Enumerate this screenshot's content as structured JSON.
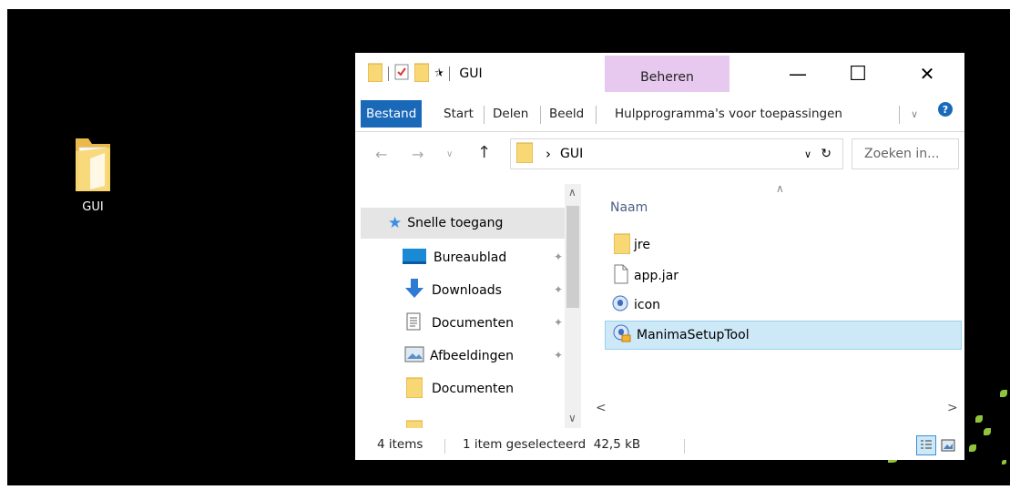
{
  "desktop": {
    "icon_label": "GUI"
  },
  "window": {
    "title": "GUI",
    "qat_dropdown": "⯫",
    "context_tab": "Beheren",
    "buttons": {
      "minimize": "—",
      "maximize": "☐",
      "close": "✕"
    }
  },
  "ribbon": {
    "tabs": [
      "Bestand",
      "Start",
      "Delen",
      "Beeld",
      "Hulpprogramma's voor toepassingen"
    ],
    "expand": "∨",
    "help": "?"
  },
  "address": {
    "back": "←",
    "forward": "→",
    "recent": "∨",
    "up": "↑",
    "crumb_separator": "›",
    "path": "GUI",
    "dropdown": "∨",
    "refresh": "↻",
    "search_placeholder": "Zoeken in..."
  },
  "nav_pane": {
    "items": [
      {
        "label": "Snelle toegang",
        "icon": "star-icon",
        "pinned": false,
        "selected": true
      },
      {
        "label": "Bureaublad",
        "icon": "desktop-icon",
        "pinned": true
      },
      {
        "label": "Downloads",
        "icon": "download-icon",
        "pinned": true
      },
      {
        "label": "Documenten",
        "icon": "document-icon",
        "pinned": true
      },
      {
        "label": "Afbeeldingen",
        "icon": "picture-icon",
        "pinned": true
      },
      {
        "label": "Documenten",
        "icon": "folder-icon",
        "pinned": false
      }
    ],
    "pin_glyph": "📌",
    "scroll_up": "∧",
    "scroll_down": "∨"
  },
  "file_list": {
    "column": "Naam",
    "sort_indicator": "∧",
    "files": [
      {
        "name": "jre",
        "icon": "folder-icon"
      },
      {
        "name": "app.jar",
        "icon": "file-icon"
      },
      {
        "name": "icon",
        "icon": "icon-file-icon"
      },
      {
        "name": "ManimaSetupTool",
        "icon": "setup-app-icon",
        "selected": true
      }
    ],
    "scroll_left": "<",
    "scroll_right": ">"
  },
  "status_bar": {
    "item_count": "4 items",
    "selection": "1 item geselecteerd  42,5 kB"
  },
  "colors": {
    "ribbon_active": "#1a69b9",
    "context_tab": "#e7c9f0",
    "selection_bg": "#cde8f7",
    "folder_yellow": "#f8d775"
  }
}
